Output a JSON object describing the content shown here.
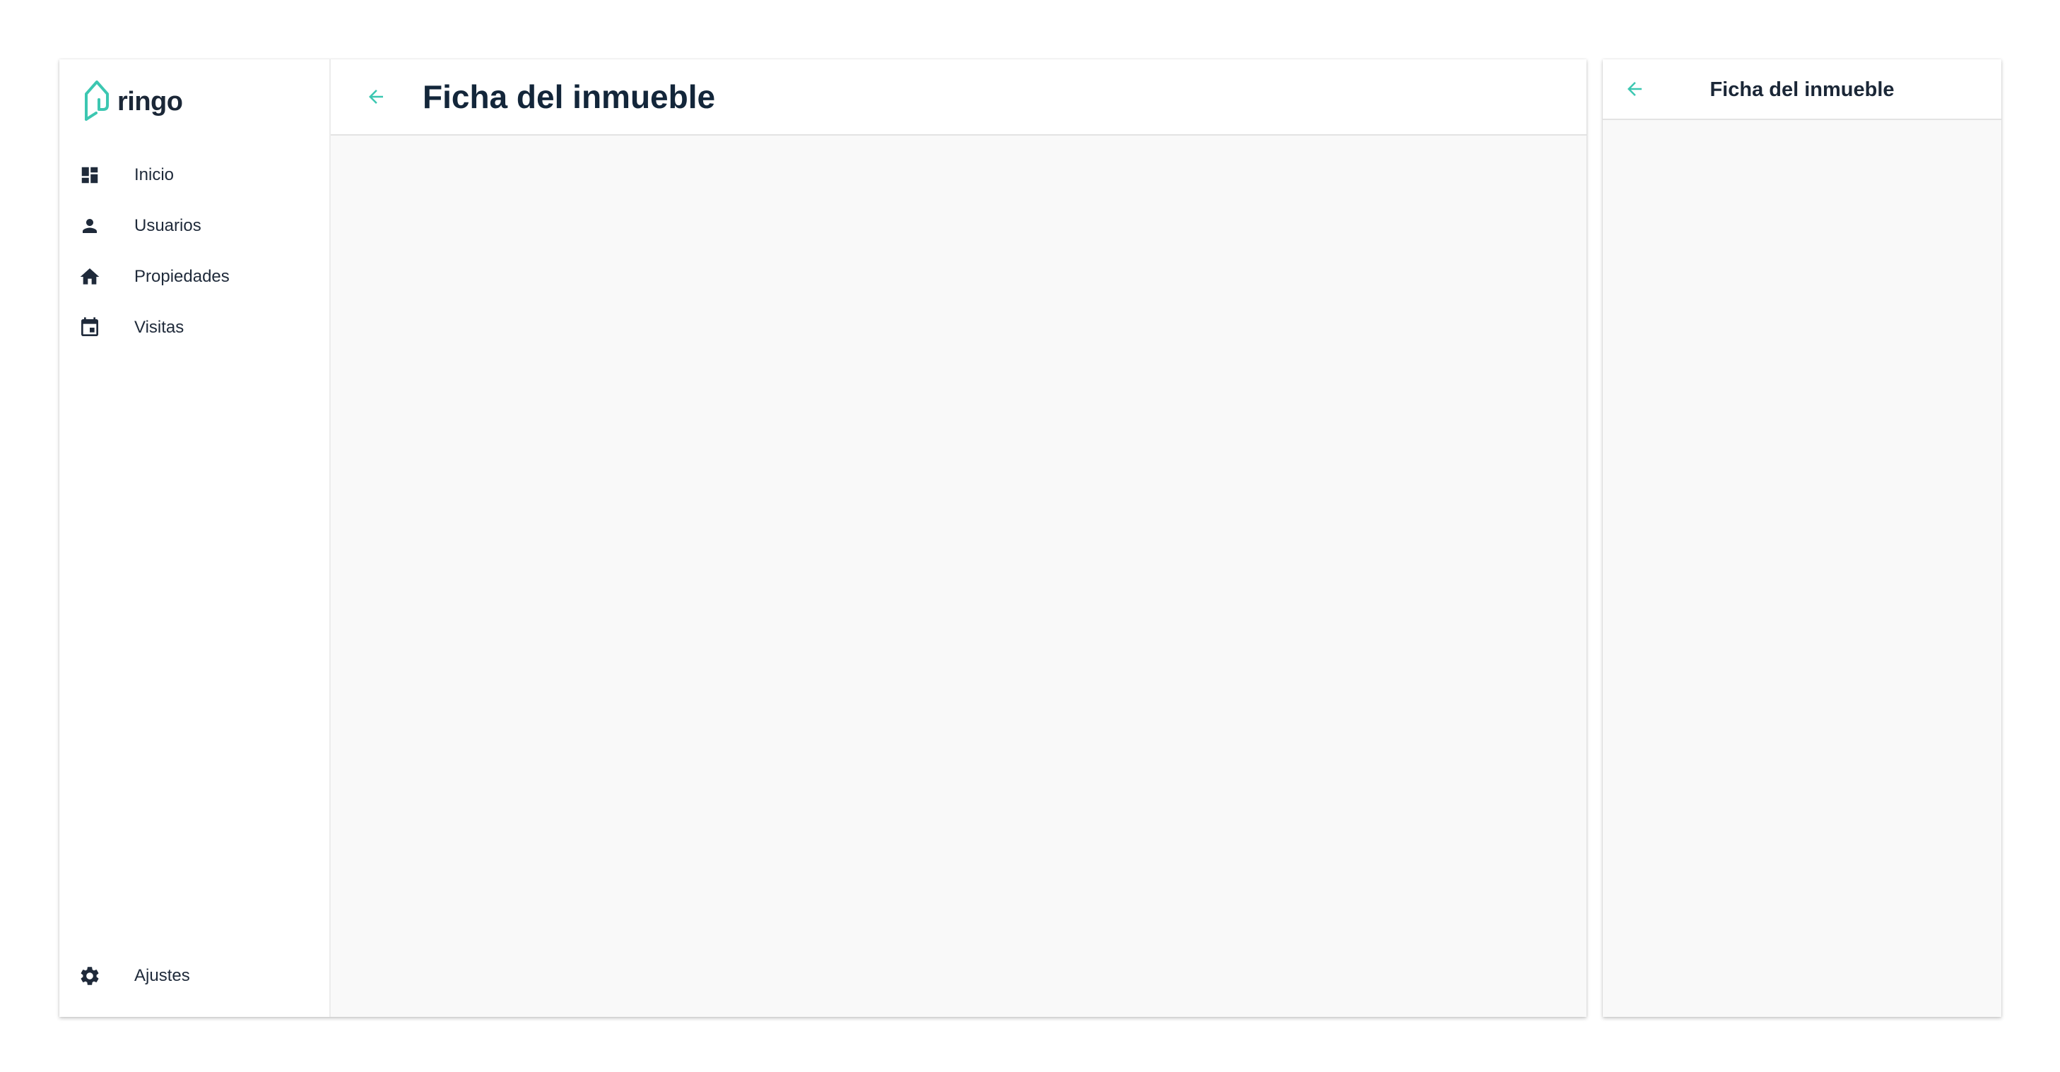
{
  "brand": {
    "name": "ringo",
    "accent_color": "#3cc7b1",
    "text_color": "#1b2737"
  },
  "sidebar": {
    "items": [
      {
        "label": "Inicio",
        "icon": "dashboard-icon"
      },
      {
        "label": "Usuarios",
        "icon": "person-icon"
      },
      {
        "label": "Propiedades",
        "icon": "home-icon"
      },
      {
        "label": "Visitas",
        "icon": "calendar-icon"
      }
    ],
    "settings": {
      "label": "Ajustes",
      "icon": "gear-icon"
    }
  },
  "main": {
    "title": "Ficha del inmueble",
    "back_icon": "arrow-left-icon"
  },
  "mobile": {
    "title": "Ficha del inmueble",
    "back_icon": "arrow-left-icon"
  }
}
